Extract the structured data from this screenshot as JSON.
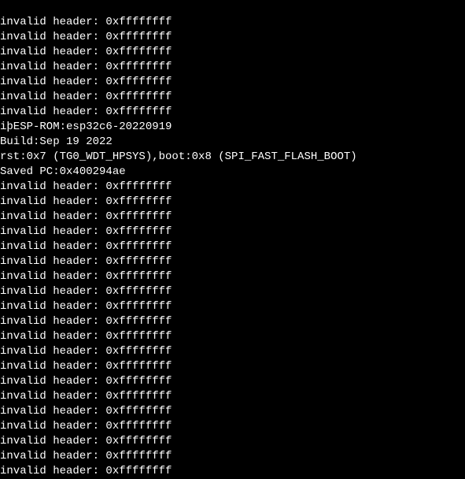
{
  "terminal": {
    "lines": [
      "invalid header: 0xffffffff",
      "invalid header: 0xffffffff",
      "invalid header: 0xffffffff",
      "invalid header: 0xffffffff",
      "invalid header: 0xffffffff",
      "invalid header: 0xffffffff",
      "invalid header: 0xffffffff",
      "iþESP-ROM:esp32c6-20220919",
      "Build:Sep 19 2022",
      "rst:0x7 (TG0_WDT_HPSYS),boot:0x8 (SPI_FAST_FLASH_BOOT)",
      "Saved PC:0x400294ae",
      "invalid header: 0xffffffff",
      "invalid header: 0xffffffff",
      "invalid header: 0xffffffff",
      "invalid header: 0xffffffff",
      "invalid header: 0xffffffff",
      "invalid header: 0xffffffff",
      "invalid header: 0xffffffff",
      "invalid header: 0xffffffff",
      "invalid header: 0xffffffff",
      "invalid header: 0xffffffff",
      "invalid header: 0xffffffff",
      "invalid header: 0xffffffff",
      "invalid header: 0xffffffff",
      "invalid header: 0xffffffff",
      "invalid header: 0xffffffff",
      "invalid header: 0xffffffff",
      "invalid header: 0xffffffff",
      "invalid header: 0xffffffff",
      "invalid header: 0xffffffff",
      "invalid header: 0xffffffff"
    ]
  }
}
